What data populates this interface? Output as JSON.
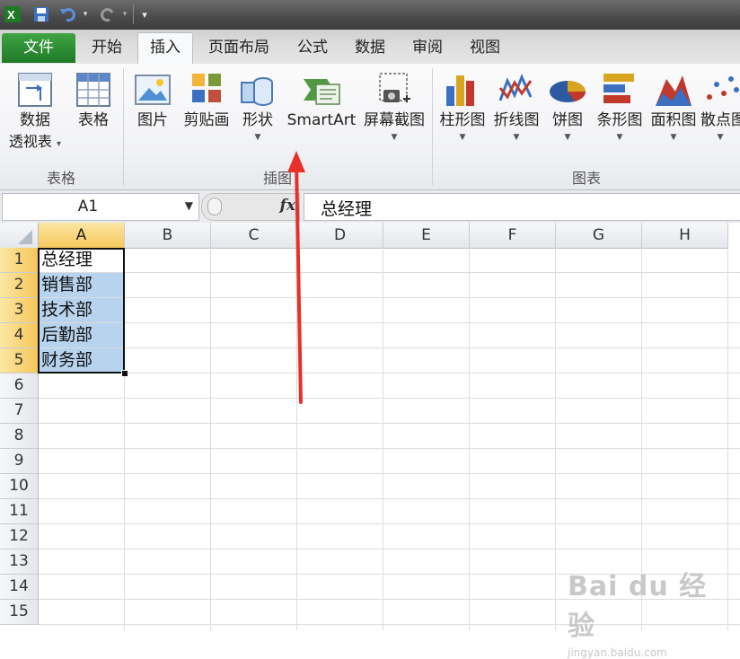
{
  "quick_access": {
    "app_icon": "excel-logo",
    "save_icon": "save-icon",
    "undo_icon": "undo-icon",
    "redo_icon": "redo-icon",
    "customize_icon": "customize-dropdown-icon"
  },
  "tabs": [
    {
      "label": "文件",
      "active": false
    },
    {
      "label": "开始",
      "active": false
    },
    {
      "label": "插入",
      "active": true
    },
    {
      "label": "页面布局",
      "active": false
    },
    {
      "label": "公式",
      "active": false
    },
    {
      "label": "数据",
      "active": false
    },
    {
      "label": "审阅",
      "active": false
    },
    {
      "label": "视图",
      "active": false
    }
  ],
  "ribbon": {
    "groups": {
      "tables": "表格",
      "illustrations": "插图",
      "charts": "图表"
    },
    "buttons": {
      "pivot_line1": "数据",
      "pivot_line2": "透视表",
      "table": "表格",
      "picture": "图片",
      "clipart": "剪贴画",
      "shapes": "形状",
      "smartart": "SmartArt",
      "screenshot": "屏幕截图",
      "column": "柱形图",
      "line": "折线图",
      "pie": "饼图",
      "bar": "条形图",
      "area": "面积图",
      "scatter": "散点图"
    }
  },
  "formula_bar": {
    "name_box": "A1",
    "fx": "fx",
    "content": "总经理"
  },
  "columns": [
    "A",
    "B",
    "C",
    "D",
    "E",
    "F",
    "G",
    "H"
  ],
  "rows": [
    "1",
    "2",
    "3",
    "4",
    "5",
    "6",
    "7",
    "8",
    "9",
    "10",
    "11",
    "12",
    "13",
    "14",
    "15"
  ],
  "cells": {
    "A1": "总经理",
    "A2": "销售部",
    "A3": "技术部",
    "A4": "后勤部",
    "A5": "财务部"
  },
  "selection": "A1:A5",
  "watermark": {
    "brand": "Bai du 经验",
    "url": "jingyan.baidu.com"
  },
  "colors": {
    "accent_file_tab": "#2e8b36",
    "selection_fill": "#b7d3ee",
    "header_selected": "#f6c65a",
    "arrow": "#e8302a"
  }
}
